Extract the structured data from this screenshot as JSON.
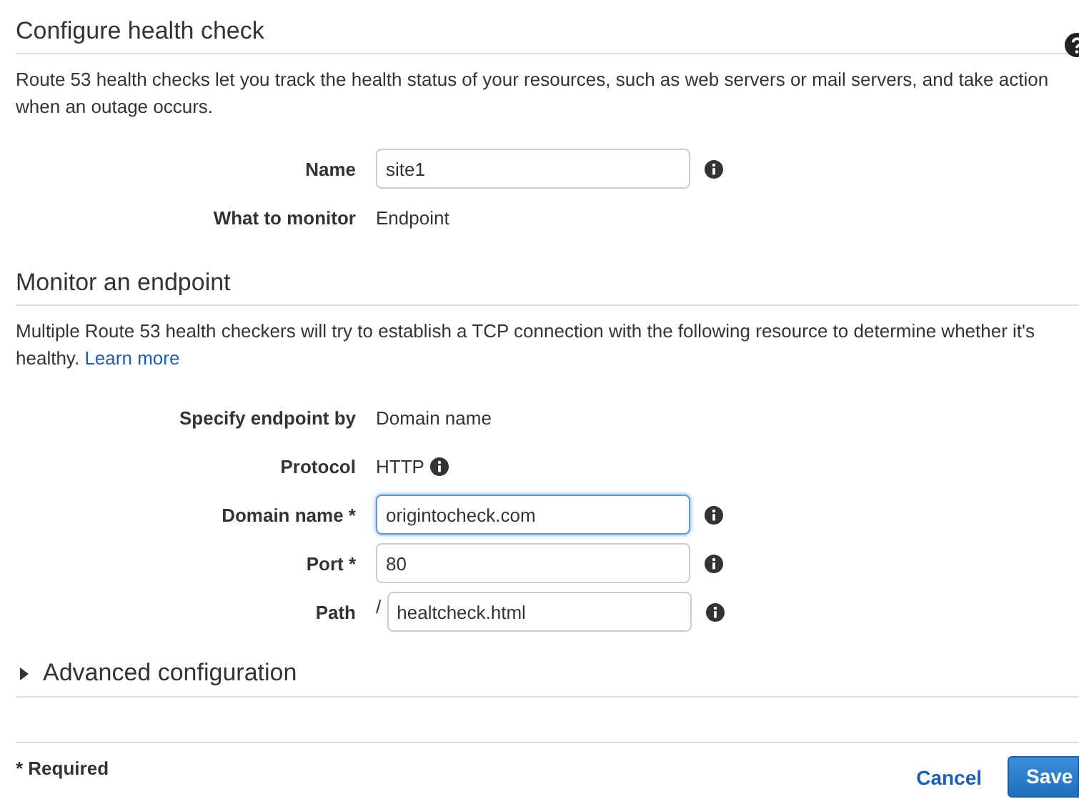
{
  "sections": [
    {
      "title": "Configure health check",
      "help": true,
      "description": "Route 53 health checks let you track the health status of your resources, such as web servers or mail servers, and take action when an outage occurs.",
      "fields": [
        {
          "kind": "input",
          "label": "Name",
          "value": "site1",
          "focused": false,
          "info": true
        },
        {
          "kind": "text",
          "label": "What to monitor",
          "value": "Endpoint",
          "info": false
        }
      ]
    },
    {
      "title": "Monitor an endpoint",
      "help": false,
      "description": "Multiple Route 53 health checkers will try to establish a TCP connection with the following resource to determine whether it's healthy.",
      "link": "Learn more",
      "fields": [
        {
          "kind": "text",
          "label": "Specify endpoint by",
          "value": "Domain name",
          "info": false
        },
        {
          "kind": "text",
          "label": "Protocol",
          "value": "HTTP",
          "info": true
        },
        {
          "kind": "input",
          "label": "Domain name *",
          "value": "origintocheck.com",
          "focused": true,
          "info": true
        },
        {
          "kind": "input",
          "label": "Port *",
          "value": "80",
          "focused": false,
          "info": true
        },
        {
          "kind": "path",
          "label": "Path",
          "prefix": "/",
          "value": "healtcheck.html",
          "focused": false,
          "info": true
        }
      ]
    }
  ],
  "advanced": {
    "label": "Advanced configuration",
    "expanded": false
  },
  "footer": {
    "note": "* Required",
    "cancel": "Cancel",
    "save": "Save"
  }
}
